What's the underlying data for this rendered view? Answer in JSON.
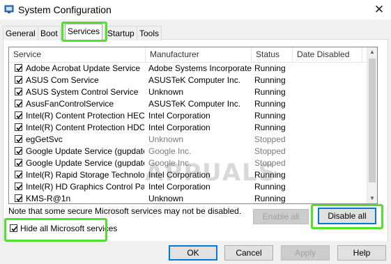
{
  "window": {
    "title": "System Configuration",
    "close_glyph": "✕"
  },
  "tabs": [
    {
      "label": "General",
      "active": false
    },
    {
      "label": "Boot",
      "active": false
    },
    {
      "label": "Services",
      "active": true
    },
    {
      "label": "Startup",
      "active": false
    },
    {
      "label": "Tools",
      "active": false
    }
  ],
  "list": {
    "columns": [
      "Service",
      "Manufacturer",
      "Status",
      "Date Disabled"
    ],
    "rows": [
      {
        "checked": true,
        "service": "Adobe Acrobat Update Service",
        "manufacturer": "Adobe Systems Incorporated",
        "status": "Running"
      },
      {
        "checked": true,
        "service": "ASUS Com Service",
        "manufacturer": "ASUSTeK Computer Inc.",
        "status": "Running"
      },
      {
        "checked": true,
        "service": "ASUS System Control Service",
        "manufacturer": "Unknown",
        "status": "Running"
      },
      {
        "checked": true,
        "service": "AsusFanControlService",
        "manufacturer": "ASUSTeK Computer Inc.",
        "status": "Running"
      },
      {
        "checked": true,
        "service": "Intel(R) Content Protection HEC...",
        "manufacturer": "Intel Corporation",
        "status": "Running"
      },
      {
        "checked": true,
        "service": "Intel(R) Content Protection HDC...",
        "manufacturer": "Intel Corporation",
        "status": "Running"
      },
      {
        "checked": true,
        "service": "egGetSvc",
        "manufacturer": "Unknown",
        "status": "Stopped"
      },
      {
        "checked": true,
        "service": "Google Update Service (gupdate)",
        "manufacturer": "Google Inc.",
        "status": "Stopped"
      },
      {
        "checked": true,
        "service": "Google Update Service (gupdatem)",
        "manufacturer": "Google Inc.",
        "status": "Stopped"
      },
      {
        "checked": true,
        "service": "Intel(R) Rapid Storage Technology",
        "manufacturer": "Intel Corporation",
        "status": "Running"
      },
      {
        "checked": true,
        "service": "Intel(R) HD Graphics Control Pa...",
        "manufacturer": "Intel Corporation",
        "status": "Running"
      },
      {
        "checked": true,
        "service": "KMS-R@1n",
        "manufacturer": "Unknown",
        "status": "Running"
      }
    ]
  },
  "note": "Note that some secure Microsoft services may not be disabled.",
  "buttons": {
    "enable_all": "Enable all",
    "disable_all": "Disable all",
    "ok": "OK",
    "cancel": "Cancel",
    "apply": "Apply",
    "help": "Help"
  },
  "hide_ms": {
    "label": "Hide all Microsoft services",
    "checked": true
  },
  "watermark": "APPUALS",
  "colors": {
    "highlight": "#52e02a",
    "primary_border": "#0078d7"
  }
}
